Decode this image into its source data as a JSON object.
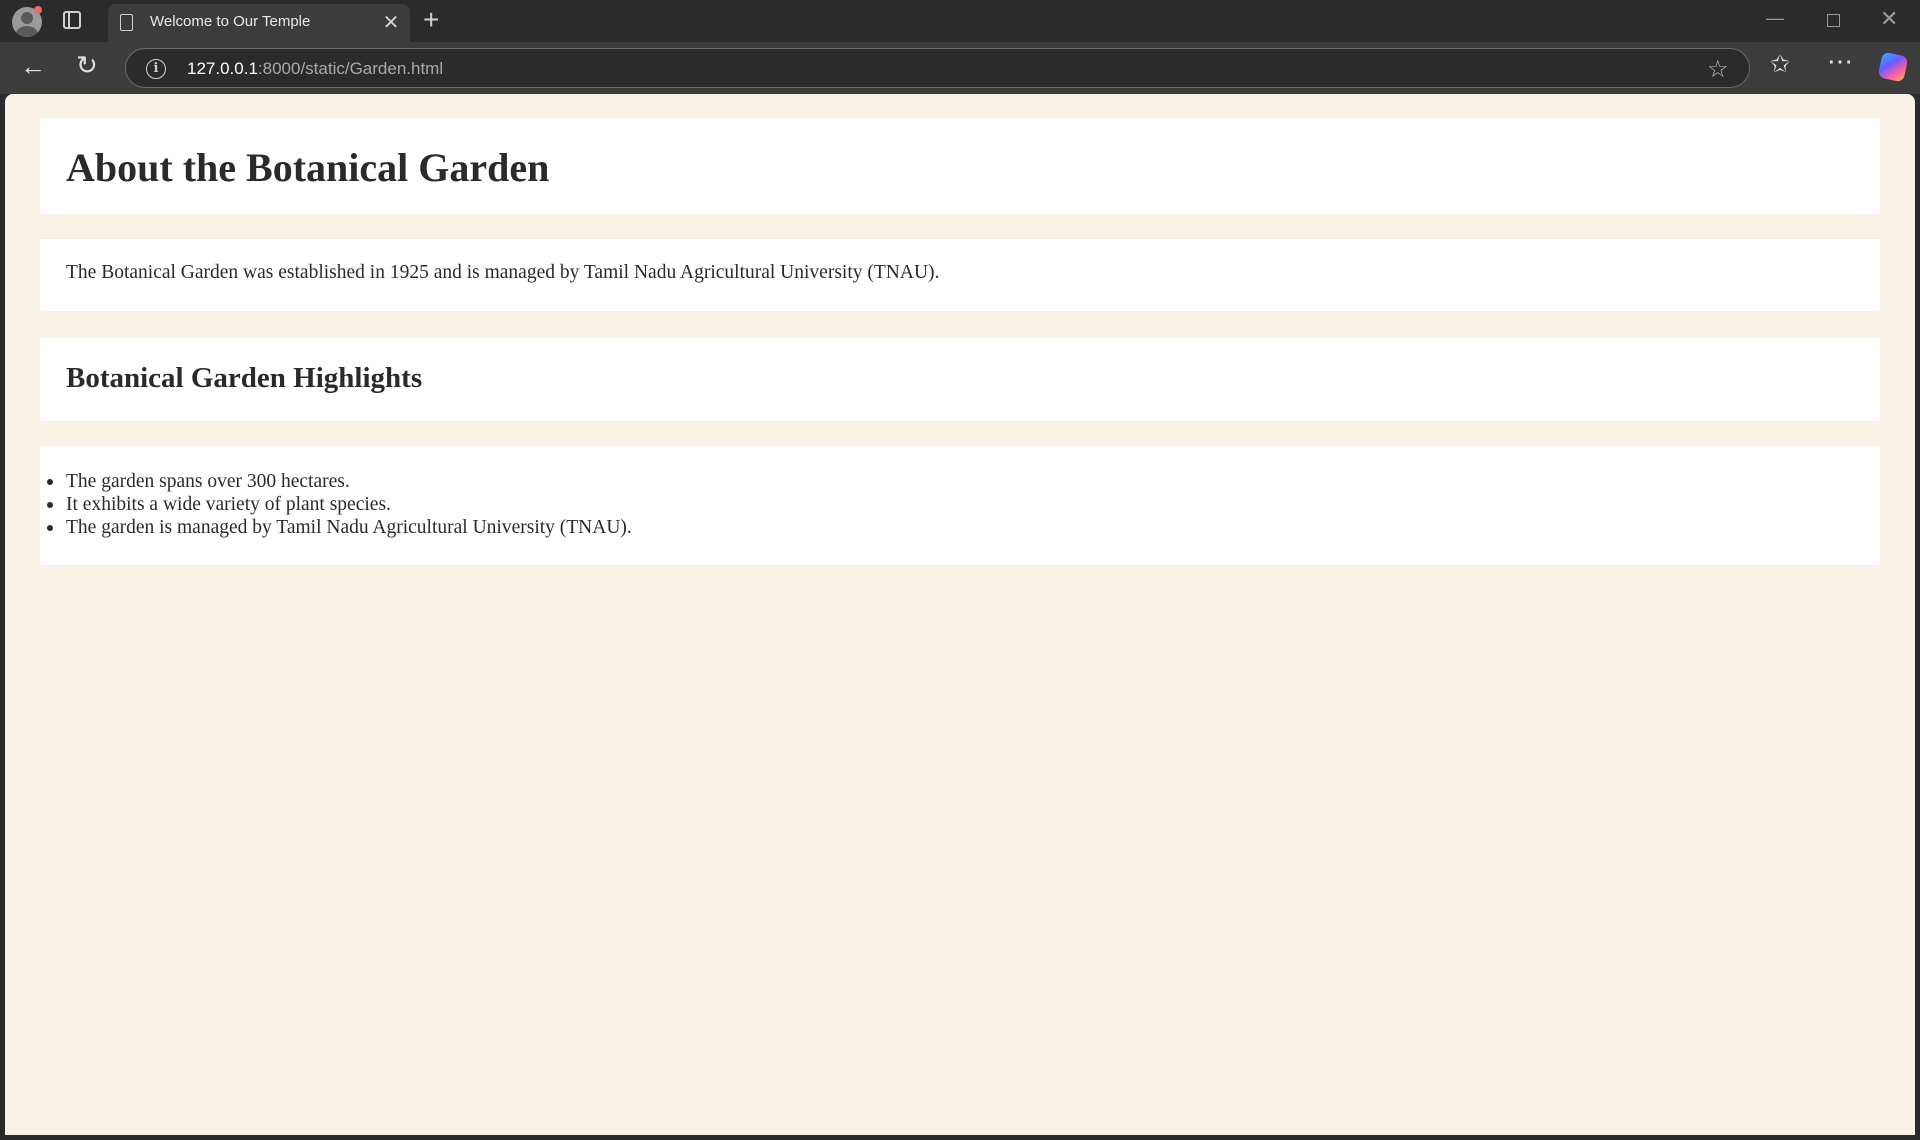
{
  "browser": {
    "tab_title": "Welcome to Our Temple",
    "tab_close": "✕",
    "new_tab": "+",
    "url_host": "127.0.0.1",
    "url_rest": ":8000/static/Garden.html",
    "icons": {
      "profile": "profile-avatar-icon",
      "tab_actions": "tab-actions-icon",
      "page": "page-icon",
      "back": "back-arrow-icon",
      "reload": "reload-icon",
      "info": "info-icon",
      "favorite": "star-icon",
      "favorites": "favorites-icon",
      "more": "more-icon",
      "copilot": "copilot-icon",
      "minimize": "minimize-icon",
      "maximize": "maximize-icon",
      "close": "close-icon"
    },
    "glyphs": {
      "back": "←",
      "reload": "↻",
      "info": "i",
      "star": "☆",
      "favorites": "✩",
      "more": "⋯",
      "minimize": "—",
      "close": "✕"
    }
  },
  "page": {
    "title": "About the Botanical Garden",
    "intro": "The Botanical Garden was established in 1925 and is managed by Tamil Nadu Agricultural University (TNAU).",
    "highlights_heading": "Botanical Garden Highlights",
    "highlights": [
      "The garden spans over 300 hectares.",
      "It exhibits a wide variety of plant species.",
      "The garden is managed by Tamil Nadu Agricultural University (TNAU)."
    ],
    "colors": {
      "background": "#f8f1e5",
      "panel": "#ffffff",
      "text": "#2a2a2a"
    }
  }
}
